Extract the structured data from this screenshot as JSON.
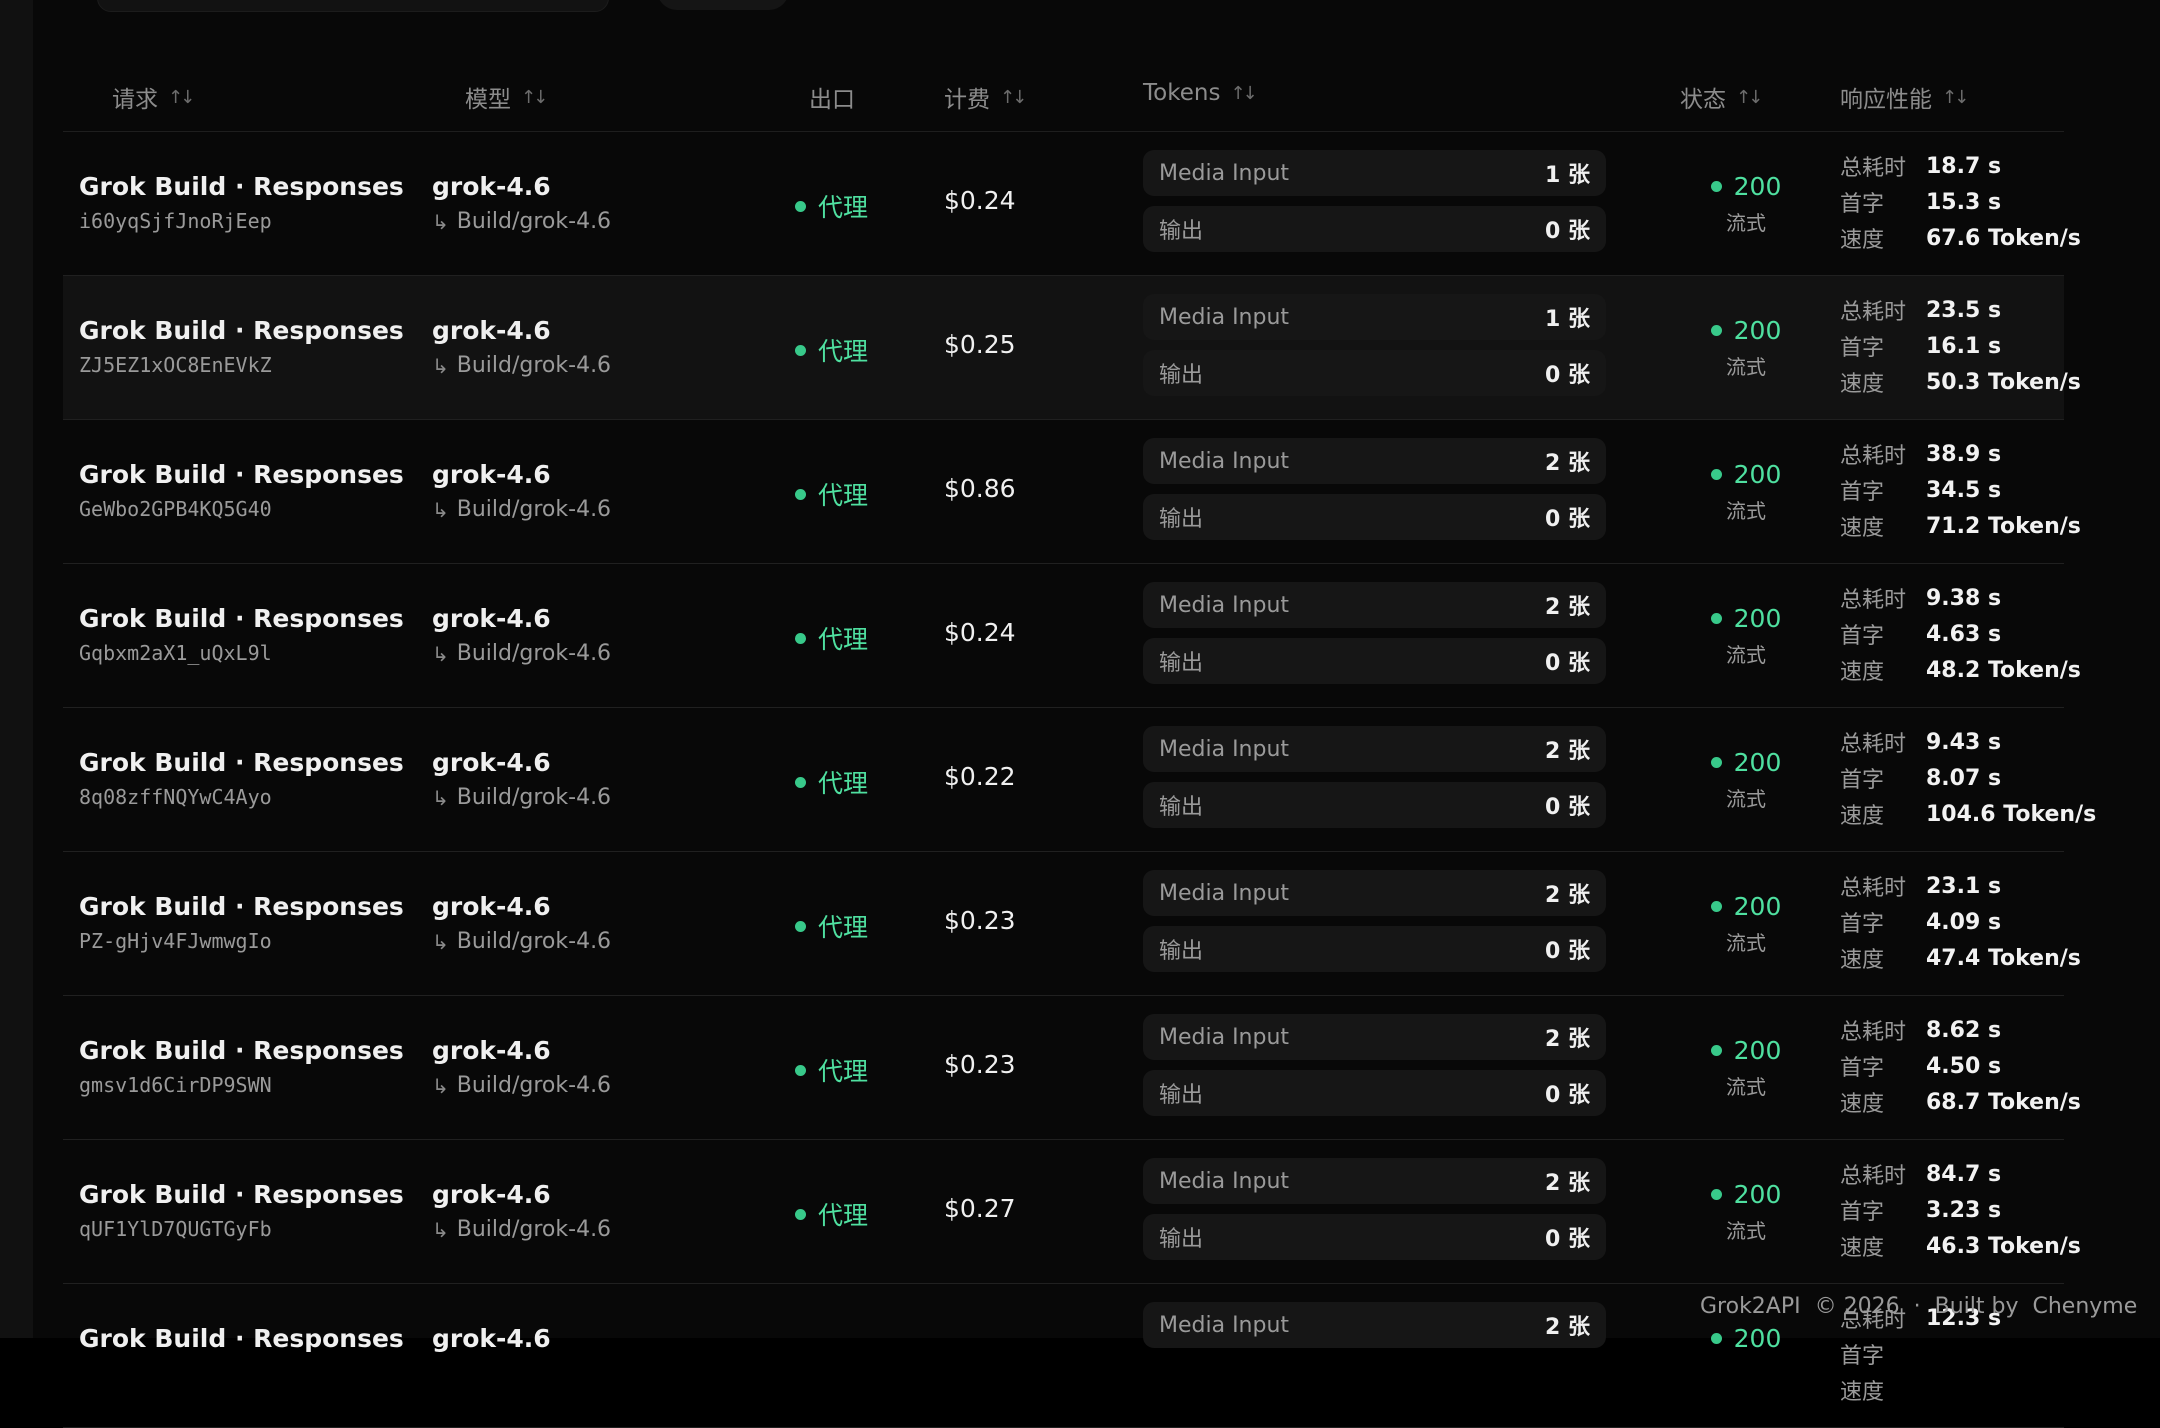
{
  "header": {
    "request": "请求",
    "model": "模型",
    "exit": "出口",
    "cost": "计费",
    "tokens": "Tokens",
    "status": "状态",
    "perf": "响应性能"
  },
  "perf_labels": {
    "total": "总耗时",
    "first": "首字",
    "speed": "速度"
  },
  "rows": [
    {
      "title": "Grok Build · Responses",
      "id": "i60yqSjfJnoRjEep",
      "model": "grok-4.6",
      "route": "Build/grok-4.6",
      "exit": "代理",
      "cost": "$0.24",
      "tok1_name": "Media Input",
      "tok1_val": "1 张",
      "tok2_name": "输出",
      "tok2_val": "0 张",
      "status": "200",
      "status_sub": "流式",
      "total": "18.7 s",
      "first": "15.3 s",
      "speed": "67.6 Token/s"
    },
    {
      "title": "Grok Build · Responses",
      "id": "ZJ5EZ1xOC8EnEVkZ",
      "model": "grok-4.6",
      "route": "Build/grok-4.6",
      "exit": "代理",
      "cost": "$0.25",
      "tok1_name": "Media Input",
      "tok1_val": "1 张",
      "tok2_name": "输出",
      "tok2_val": "0 张",
      "status": "200",
      "status_sub": "流式",
      "total": "23.5 s",
      "first": "16.1 s",
      "speed": "50.3 Token/s"
    },
    {
      "title": "Grok Build · Responses",
      "id": "GeWbo2GPB4KQ5G40",
      "model": "grok-4.6",
      "route": "Build/grok-4.6",
      "exit": "代理",
      "cost": "$0.86",
      "tok1_name": "Media Input",
      "tok1_val": "2 张",
      "tok2_name": "输出",
      "tok2_val": "0 张",
      "status": "200",
      "status_sub": "流式",
      "total": "38.9 s",
      "first": "34.5 s",
      "speed": "71.2 Token/s"
    },
    {
      "title": "Grok Build · Responses",
      "id": "Gqbxm2aX1_uQxL9l",
      "model": "grok-4.6",
      "route": "Build/grok-4.6",
      "exit": "代理",
      "cost": "$0.24",
      "tok1_name": "Media Input",
      "tok1_val": "2 张",
      "tok2_name": "输出",
      "tok2_val": "0 张",
      "status": "200",
      "status_sub": "流式",
      "total": "9.38 s",
      "first": "4.63 s",
      "speed": "48.2 Token/s"
    },
    {
      "title": "Grok Build · Responses",
      "id": "8q08zffNQYwC4Ayo",
      "model": "grok-4.6",
      "route": "Build/grok-4.6",
      "exit": "代理",
      "cost": "$0.22",
      "tok1_name": "Media Input",
      "tok1_val": "2 张",
      "tok2_name": "输出",
      "tok2_val": "0 张",
      "status": "200",
      "status_sub": "流式",
      "total": "9.43 s",
      "first": "8.07 s",
      "speed": "104.6 Token/s"
    },
    {
      "title": "Grok Build · Responses",
      "id": "PZ-gHjv4FJwmwgIo",
      "model": "grok-4.6",
      "route": "Build/grok-4.6",
      "exit": "代理",
      "cost": "$0.23",
      "tok1_name": "Media Input",
      "tok1_val": "2 张",
      "tok2_name": "输出",
      "tok2_val": "0 张",
      "status": "200",
      "status_sub": "流式",
      "total": "23.1 s",
      "first": "4.09 s",
      "speed": "47.4 Token/s"
    },
    {
      "title": "Grok Build · Responses",
      "id": "gmsv1d6CirDP9SWN",
      "model": "grok-4.6",
      "route": "Build/grok-4.6",
      "exit": "代理",
      "cost": "$0.23",
      "tok1_name": "Media Input",
      "tok1_val": "2 张",
      "tok2_name": "输出",
      "tok2_val": "0 张",
      "status": "200",
      "status_sub": "流式",
      "total": "8.62 s",
      "first": "4.50 s",
      "speed": "68.7 Token/s"
    },
    {
      "title": "Grok Build · Responses",
      "id": "qUF1YlD7QUGTGyFb",
      "model": "grok-4.6",
      "route": "Build/grok-4.6",
      "exit": "代理",
      "cost": "$0.27",
      "tok1_name": "Media Input",
      "tok1_val": "2 张",
      "tok2_name": "输出",
      "tok2_val": "0 张",
      "status": "200",
      "status_sub": "流式",
      "total": "84.7 s",
      "first": "3.23 s",
      "speed": "46.3 Token/s"
    },
    {
      "title": "Grok Build · Responses",
      "id": "",
      "model": "grok-4.6",
      "route": "",
      "exit": "",
      "cost": "",
      "tok1_name": "Media Input",
      "tok1_val": "2 张",
      "tok2_name": "",
      "tok2_val": "",
      "status": "200",
      "status_sub": "",
      "total": "12.3 s",
      "first": "",
      "speed": ""
    }
  ],
  "footer": {
    "brand": "Grok2API",
    "copyright": "© 2026",
    "sep": "·",
    "built": "Built by",
    "author": "Chenyme"
  },
  "colors": {
    "accent_green": "#4fe0a0",
    "dot_green": "#38c98a"
  }
}
